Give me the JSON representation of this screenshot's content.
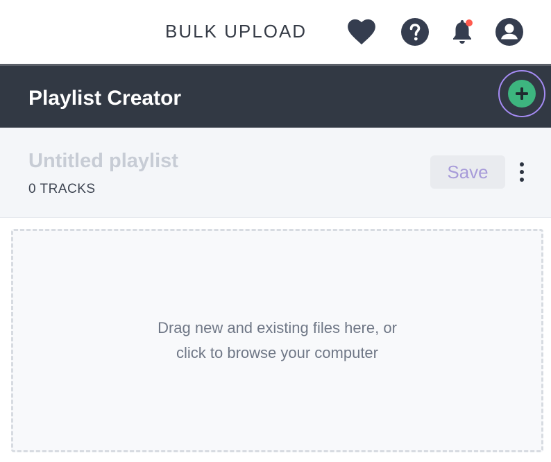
{
  "topbar": {
    "bulk_upload_label": "BULK UPLOAD",
    "icons": [
      "heart-icon",
      "help-icon",
      "bell-icon",
      "user-account-icon"
    ],
    "notification_dot_color": "#ff5a4e"
  },
  "header": {
    "title": "Playlist Creator",
    "add_icon": "plus-icon",
    "accent_color": "#3db57f",
    "focus_ring_color": "#a58bf4"
  },
  "playlist": {
    "name_placeholder": "Untitled playlist",
    "track_count": "0 TRACKS",
    "save_label": "Save",
    "more_icon": "kebab-menu-icon"
  },
  "dropzone": {
    "line1": "Drag new and existing files here, or",
    "line2": "click to browse your computer"
  }
}
